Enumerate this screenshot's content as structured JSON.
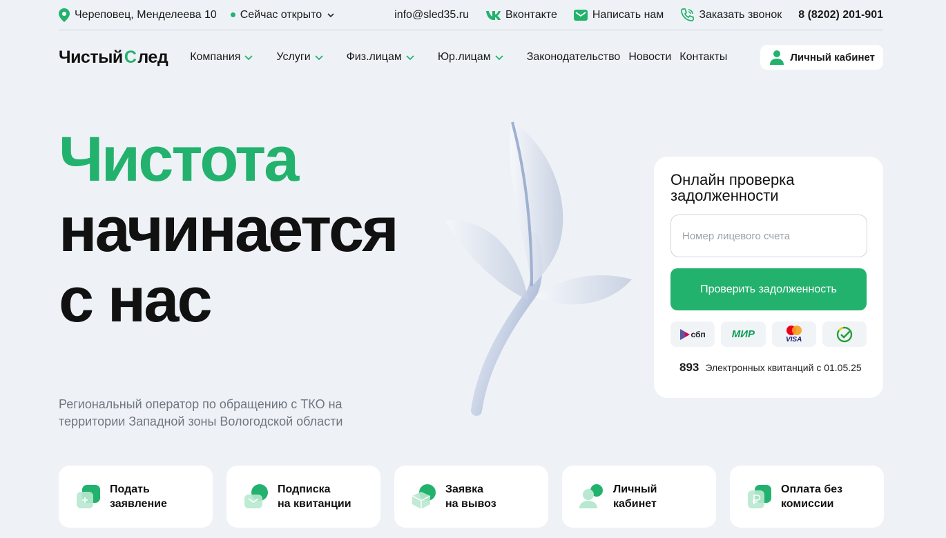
{
  "topbar": {
    "address": "Череповец, Менделеева 10",
    "status": "Сейчас открыто",
    "email": "info@sled35.ru",
    "vk": "Вконтакте",
    "write": "Написать нам",
    "call": "Заказать звонок",
    "phone": "8 (8202) 201-901"
  },
  "nav": {
    "logo_left": "Чистый",
    "logo_leaf": "С",
    "logo_right": "лед",
    "items": [
      {
        "label": "Компания"
      },
      {
        "label": "Услуги"
      },
      {
        "label": "Физ.лицам"
      },
      {
        "label": "Юр.лицам"
      },
      {
        "label": "Законодательство"
      },
      {
        "label": "Новости"
      },
      {
        "label": "Контакты"
      }
    ],
    "cabinet": "Личный кабинет"
  },
  "hero": {
    "line1": "Чистота",
    "line2": "начинается",
    "line3": "с нас",
    "subtitle": "Региональный оператор по обращению с ТКО на территории Западной зоны Вологодской области"
  },
  "debt_card": {
    "title": "Онлайн проверка задолженности",
    "placeholder": "Номер лицевого счета",
    "button": "Проверить задолженность",
    "payments": [
      "сбп",
      "МИР",
      "VISA",
      "sber"
    ],
    "receipts_count": "893",
    "receipts_label": "Электронных квитанций с 01.05.25"
  },
  "tiles": [
    {
      "label": "Подать\nзаявление"
    },
    {
      "label": "Подписка\nна квитанции"
    },
    {
      "label": "Заявка\nна вывоз"
    },
    {
      "label": "Личный\nкабинет"
    },
    {
      "label": "Оплата без\nкомиссии"
    }
  ],
  "colors": {
    "accent": "#23b26d",
    "background": "#eef2f6"
  }
}
